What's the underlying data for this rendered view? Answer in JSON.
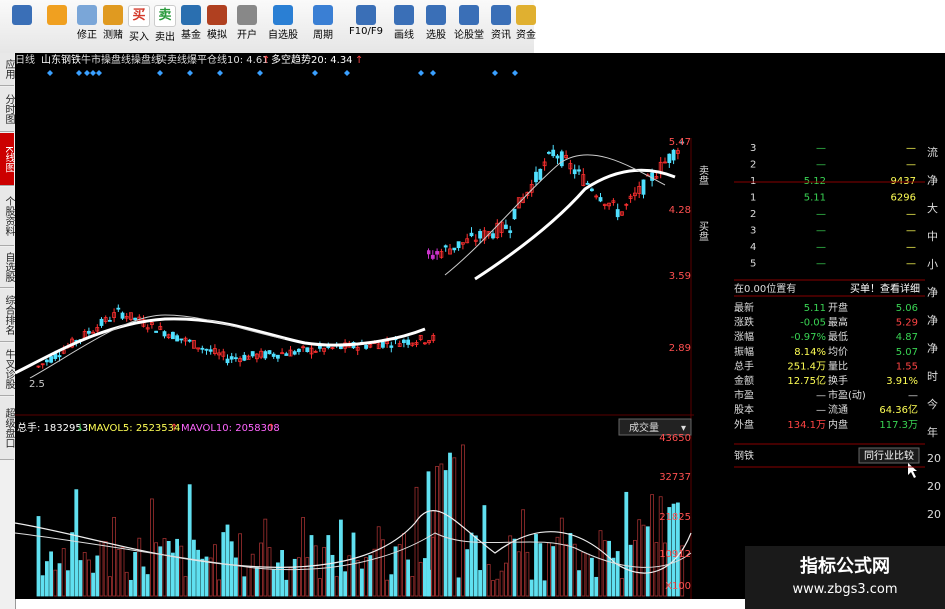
{
  "toolbar": {
    "items": [
      {
        "label": "",
        "icon": "grid-icon"
      },
      {
        "label": "",
        "icon": "back-arrow-icon"
      },
      {
        "label": "修正",
        "icon": "up-down-arrow-icon"
      },
      {
        "label": "测赌",
        "icon": "dice-icon"
      },
      {
        "label": "买入",
        "icon": "buy-icon",
        "glyph": "买"
      },
      {
        "label": "卖出",
        "icon": "sell-icon",
        "glyph": "卖"
      },
      {
        "label": "基金",
        "icon": "fund-icon"
      },
      {
        "label": "模拟",
        "icon": "gavel-icon"
      },
      {
        "label": "开户",
        "icon": "lock-icon"
      },
      {
        "label": "自选股",
        "icon": "star-list-icon"
      },
      {
        "label": "周期",
        "icon": "clock-icon"
      },
      {
        "label": "F10/F9",
        "icon": "chart-icon"
      },
      {
        "label": "画线",
        "icon": "pen-icon"
      },
      {
        "label": "选股",
        "icon": "filter-icon"
      },
      {
        "label": "论股堂",
        "icon": "chat-icon"
      },
      {
        "label": "资讯",
        "icon": "news-icon"
      },
      {
        "label": "资金",
        "icon": "money-icon"
      }
    ],
    "colors": {
      "buy": "#d43b2c",
      "sell": "#2a9a3c"
    }
  },
  "side_tabs": [
    {
      "label": "应用"
    },
    {
      "label": "分时图"
    },
    {
      "label": "K线图",
      "active": true
    },
    {
      "label": "个股资料"
    },
    {
      "label": "自选股"
    },
    {
      "label": "综合排名"
    },
    {
      "label": "牛叉诊股"
    },
    {
      "label": "超级盘口"
    }
  ],
  "header": {
    "period": "日线",
    "stock": "山东钢铁",
    "indicator": "牛市操盘线操盘线",
    "line1": "买卖线爆平仓线10: 4.61",
    "line1_arrow": "↑",
    "line2": "多空趋势20: 4.34",
    "line2_arrow": "↑"
  },
  "price_axis": [
    "5.47",
    "4.28",
    "3.59",
    "2.89"
  ],
  "volume_header": {
    "total": "总手: 1832953",
    "total_arrow": "↓",
    "mavol5": "MAVOL5: 2523534",
    "mavol5_arrow": "↑",
    "mavol10": "MAVOL10: 2058308",
    "mavol10_arrow": "↑",
    "dropdown": "成交量"
  },
  "volume_axis": [
    "43650",
    "32737",
    "21825",
    "10912",
    "X100"
  ],
  "low_label": "2.5",
  "order_book": {
    "sell_label": "卖盘",
    "buy_label": "买盘",
    "rows": [
      {
        "n": "3",
        "p": "—",
        "v": "—"
      },
      {
        "n": "2",
        "p": "—",
        "v": "—"
      },
      {
        "n": "1",
        "p": "5.12",
        "v": "9437"
      },
      {
        "n": "1",
        "p": "5.11",
        "v": "6296"
      },
      {
        "n": "2",
        "p": "—",
        "v": "—"
      },
      {
        "n": "3",
        "p": "—",
        "v": "—"
      },
      {
        "n": "4",
        "p": "—",
        "v": "—"
      },
      {
        "n": "5",
        "p": "—",
        "v": "—"
      }
    ],
    "position_note": "在0.00位置有",
    "detail_btn": "买单！查看详细"
  },
  "quote": {
    "rows": [
      {
        "l1": "最新",
        "v1": "5.11",
        "l2": "开盘",
        "v2": "5.06",
        "c1": "#39d353",
        "c2": "#39d353"
      },
      {
        "l1": "涨跌",
        "v1": "-0.05",
        "l2": "最高",
        "v2": "5.29",
        "c1": "#39d353",
        "c2": "#ff4444"
      },
      {
        "l1": "涨幅",
        "v1": "-0.97%",
        "l2": "最低",
        "v2": "4.87",
        "c1": "#39d353",
        "c2": "#39d353"
      },
      {
        "l1": "振幅",
        "v1": "8.14%",
        "l2": "均价",
        "v2": "5.07",
        "c1": "#ffff55",
        "c2": "#39d353"
      },
      {
        "l1": "总手",
        "v1": "251.4万",
        "l2": "量比",
        "v2": "1.55",
        "c1": "#ffff55",
        "c2": "#ff4444"
      },
      {
        "l1": "金额",
        "v1": "12.75亿",
        "l2": "换手",
        "v2": "3.91%",
        "c1": "#ffff55",
        "c2": "#ffff55"
      },
      {
        "l1": "市盈",
        "v1": "—",
        "l2": "市盈(动)",
        "v2": "—",
        "c1": "#ddd",
        "c2": "#ddd"
      },
      {
        "l1": "股本",
        "v1": "—",
        "l2": "流通",
        "v2": "64.36亿",
        "c1": "#ddd",
        "c2": "#ffff55"
      },
      {
        "l1": "外盘",
        "v1": "134.1万",
        "l2": "内盘",
        "v2": "117.3万",
        "c1": "#ff4444",
        "c2": "#39d353"
      }
    ]
  },
  "industry": {
    "label": "钢铁",
    "compare_btn": "同行业比较"
  },
  "right_strip": [
    "流",
    "净",
    "大",
    "中",
    "小",
    "净",
    "净",
    "净",
    "时",
    "今",
    "年",
    "20",
    "20",
    "20"
  ],
  "watermark": {
    "title": "指标公式网",
    "url": "www.zbgs3.com"
  }
}
